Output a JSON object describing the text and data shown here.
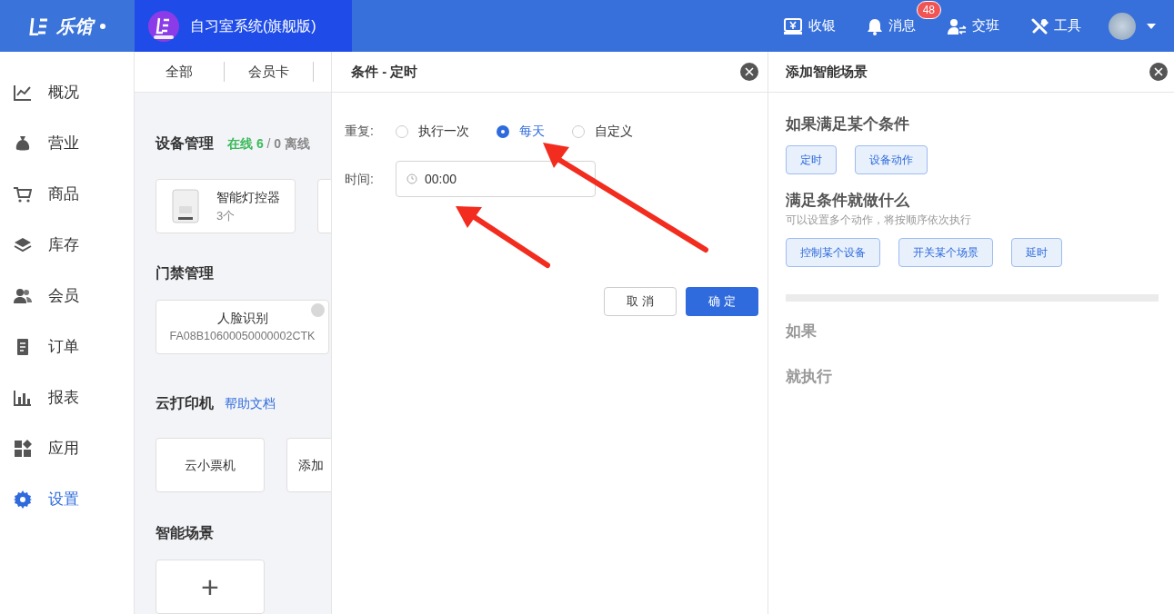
{
  "header": {
    "logo": "乐馆",
    "app_title": "自习室系统(旗舰版)",
    "actions": [
      {
        "kind": "cashier",
        "label": "收银"
      },
      {
        "kind": "bell",
        "label": "消息",
        "badge": "48"
      },
      {
        "kind": "shift",
        "label": "交班"
      },
      {
        "kind": "tools",
        "label": "工具"
      }
    ]
  },
  "sidebar": {
    "items": [
      {
        "kind": "chart",
        "label": "概况",
        "selected": false
      },
      {
        "kind": "bag",
        "label": "营业",
        "selected": false
      },
      {
        "kind": "cart",
        "label": "商品",
        "selected": false
      },
      {
        "kind": "layers",
        "label": "库存",
        "selected": false
      },
      {
        "kind": "users",
        "label": "会员",
        "selected": false
      },
      {
        "kind": "order",
        "label": "订单",
        "selected": false
      },
      {
        "kind": "bars",
        "label": "报表",
        "selected": false
      },
      {
        "kind": "apps",
        "label": "应用",
        "selected": false
      },
      {
        "kind": "gear",
        "label": "设置",
        "selected": true
      }
    ]
  },
  "main": {
    "tabs": [
      "全部",
      "会员卡"
    ],
    "device_section": {
      "title": "设备管理",
      "online": "在线 6",
      "separator": "/",
      "offline": "0 离线",
      "device": {
        "name": "智能灯控器",
        "count": "3个"
      }
    },
    "access_section": {
      "title": "门禁管理",
      "device": {
        "name": "人脸识别",
        "serial": "FA08B10600050000002CTK"
      }
    },
    "printer_section": {
      "title": "云打印机",
      "help": "帮助文档",
      "cards": [
        "云小票机",
        "添加"
      ]
    },
    "scene_section": {
      "title": "智能场景",
      "add": "+"
    }
  },
  "condition_dialog": {
    "title": "条件 - 定时",
    "repeat_label": "重复:",
    "options": [
      {
        "label": "执行一次",
        "selected": false
      },
      {
        "label": "每天",
        "selected": true
      },
      {
        "label": "自定义",
        "selected": false
      }
    ],
    "time_label": "时间:",
    "time_value": "00:00",
    "cancel": "取 消",
    "confirm": "确 定"
  },
  "scene_panel": {
    "title": "添加智能场景",
    "condition_heading": "如果满足某个条件",
    "condition_buttons": [
      "定时",
      "设备动作"
    ],
    "action_heading": "满足条件就做什么",
    "action_hint": "可以设置多个动作，将按顺序依次执行",
    "action_buttons": [
      "控制某个设备",
      "开关某个场景",
      "延时"
    ],
    "if_label": "如果",
    "then_label": "就执行"
  }
}
